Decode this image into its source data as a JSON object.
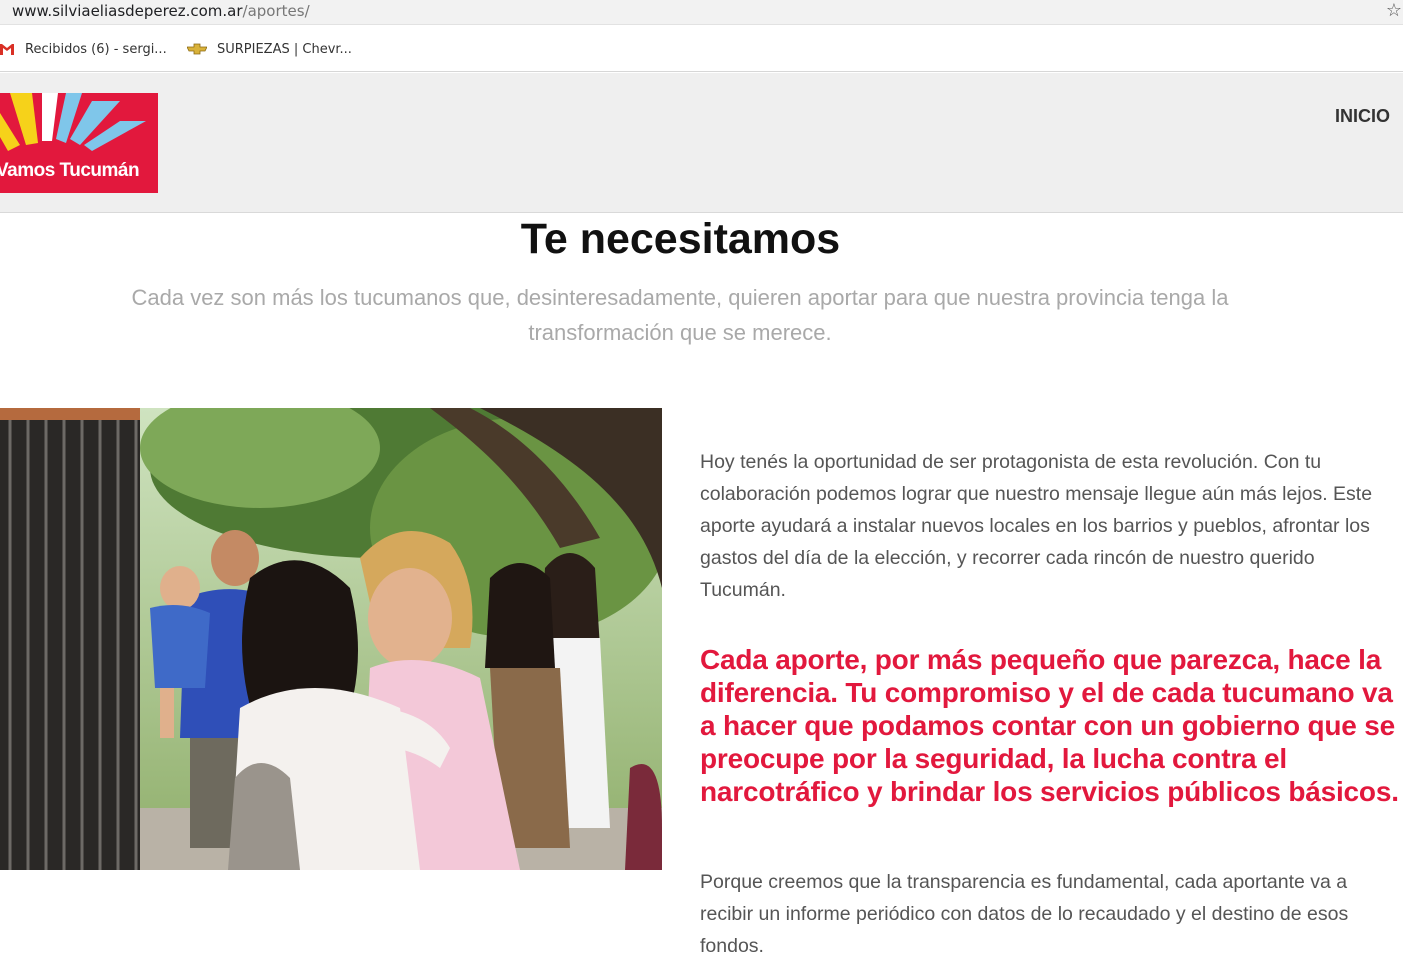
{
  "browser": {
    "url_domain": "www.silviaeliasdeperez.com.ar",
    "url_path": "/aportes/",
    "bookmarks": [
      {
        "label": "Recibidos (6) - sergi...",
        "icon": "gmail-icon"
      },
      {
        "label": "SURPIEZAS | Chevr...",
        "icon": "chevrolet-icon"
      }
    ]
  },
  "header": {
    "logo_text": "Vamos Tucumán",
    "nav": [
      {
        "label": "INICIO"
      }
    ]
  },
  "main": {
    "title": "Te necesitamos",
    "subtitle": "Cada vez son más los tucumanos que, desinteresadamente, quieren aportar para que nuestra provincia tenga la transformación que se merece.",
    "paragraph1": "Hoy tenés la oportunidad de ser protagonista de esta revolución. Con tu colaboración podemos lograr que nuestro mensaje llegue aún más lejos. Este aporte ayudará a instalar nuevos locales en los barrios y pueblos, afrontar los gastos del día de la elección, y recorrer cada rincón de nuestro querido Tucumán.",
    "highlight": "Cada aporte, por más pequeño que parezca, hace la diferencia. Tu compromiso y el de cada tucumano va a hacer que podamos contar con un gobierno que se preocupe por la seguridad, la lucha contra el narcotráfico y brindar los servicios públicos básicos.",
    "paragraph2": "Porque creemos que la transparencia es fundamental, cada aportante va a recibir un informe periódico con datos de lo recaudado y el destino de esos fondos."
  },
  "colors": {
    "brand_red": "#e2183d",
    "logo_yellow": "#f6d21a",
    "logo_blue": "#7fc6ea",
    "text_gray": "#555555",
    "subtitle_gray": "#a9a9a9"
  }
}
